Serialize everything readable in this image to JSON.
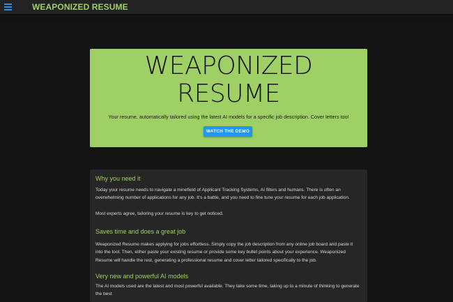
{
  "header": {
    "brand": "WEAPONIZED RESUME",
    "menu_icon": "menu-icon"
  },
  "hero": {
    "title_line1": "WEAPONIZED",
    "title_line2": "RESUME",
    "subtitle": "Your resume, automatically tailored using the latest AI models for a specific job description. Cover letters too!",
    "button_label": "WATCH THE DEMO"
  },
  "sections": [
    {
      "heading": "Why you need it",
      "paragraphs": [
        "Today your resume needs to navigate a minefield of Applicant Tracking Systems, AI filters and humans. There is often an overwhelming number of applications for any job. It's a battle, and you need to fine tune your resume for each job application.",
        "Most experts agree, tailoring your resume is key to get noticed."
      ]
    },
    {
      "heading": "Saves time and does a great job",
      "paragraphs": [
        "Weaponized Resume makes applying for jobs effortless. Simply copy the job description from any online job board and paste it into the tool. Then, either paste your existing resume or provide some key bullet points about your experience. Weaponized Resume will handle the rest, generating a professional resume and cover letter tailored specifically to the job."
      ]
    },
    {
      "heading": "Very new and powerful AI models",
      "paragraphs": [
        "The AI models used are the latest and most powerful available. They take some time, taking up to a minute of thinking to generate the best"
      ]
    }
  ],
  "colors": {
    "accent_green": "#9fd066",
    "button_blue": "#2296f3",
    "background": "#141414",
    "card": "#262626"
  }
}
